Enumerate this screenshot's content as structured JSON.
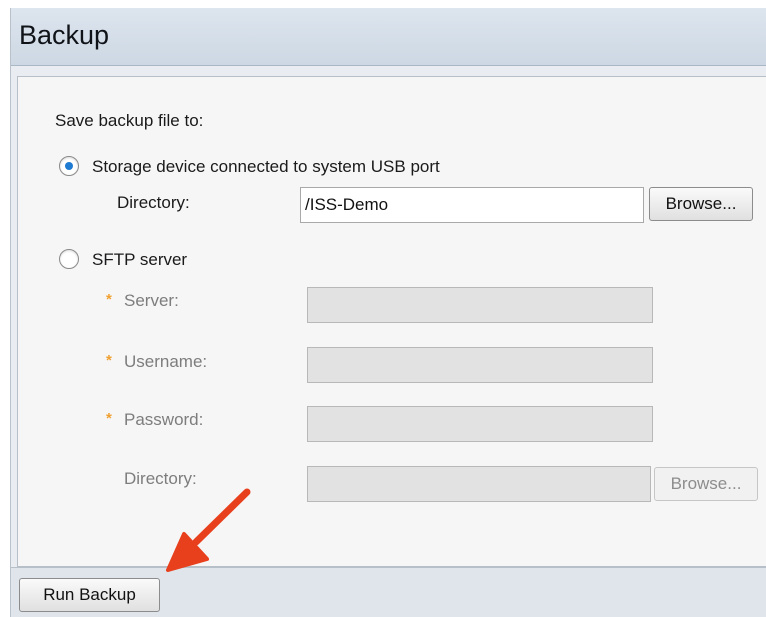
{
  "header": {
    "title": "Backup"
  },
  "form": {
    "save_to_label": "Save backup file to:",
    "usb_option": {
      "label": "Storage device connected to system USB port",
      "selected": true,
      "directory_label": "Directory:",
      "directory_value": "/ISS-Demo",
      "browse_label": "Browse..."
    },
    "sftp_option": {
      "label": "SFTP server",
      "selected": false,
      "required_marker": "*",
      "server_label": "Server:",
      "server_value": "",
      "username_label": "Username:",
      "username_value": "",
      "password_label": "Password:",
      "password_value": "",
      "directory_label": "Directory:",
      "directory_value": "",
      "browse_label": "Browse..."
    }
  },
  "footer": {
    "run_backup_label": "Run Backup"
  },
  "colors": {
    "accent": "#1f7bd1",
    "required": "#f0a030",
    "annotation_arrow": "#e8401c"
  }
}
